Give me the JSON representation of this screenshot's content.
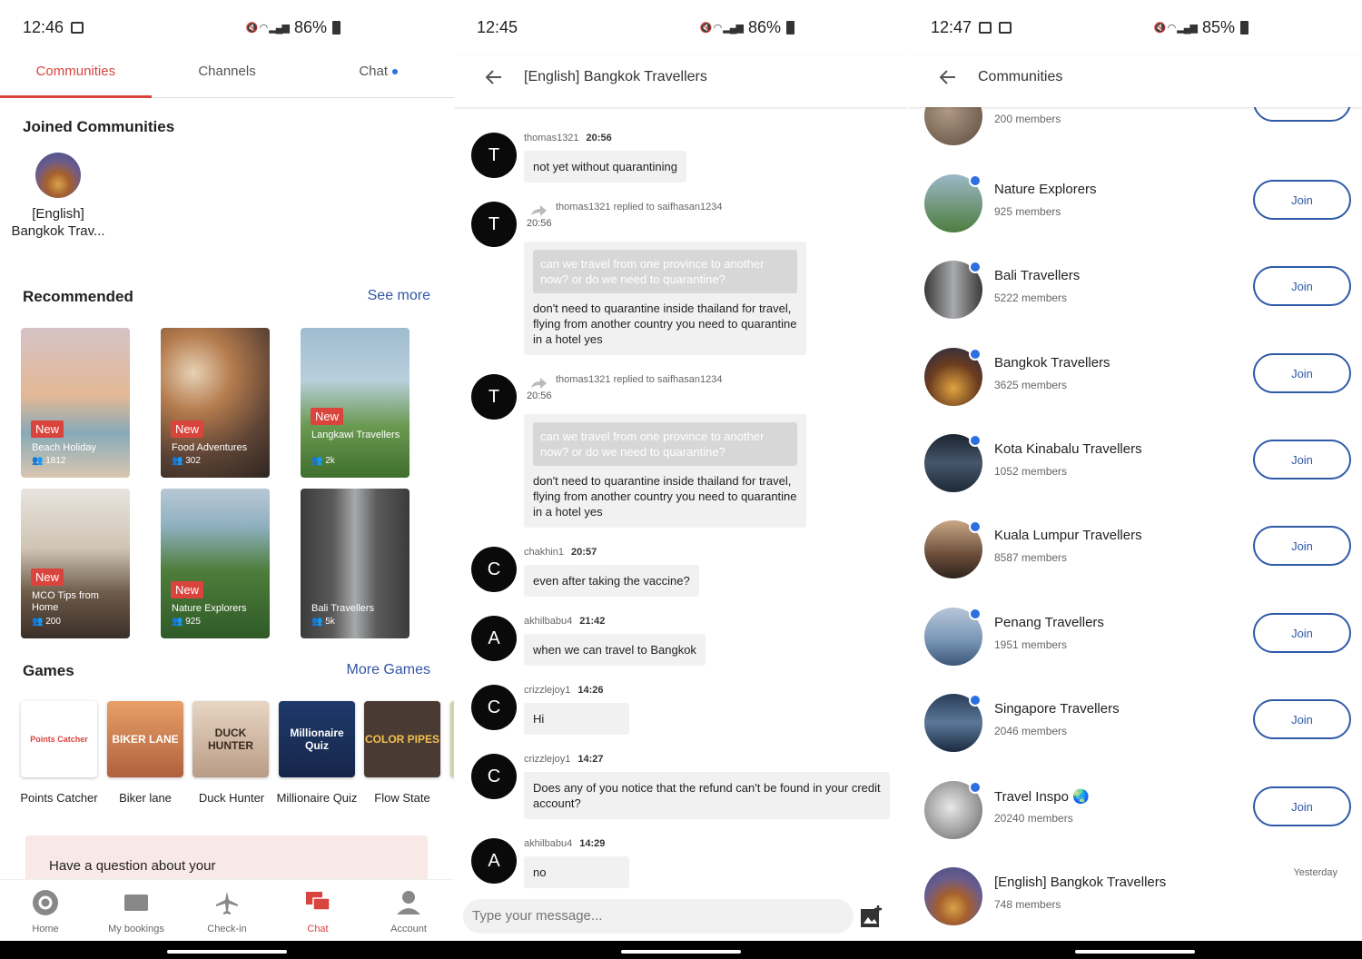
{
  "panel1": {
    "status": {
      "time": "12:46",
      "battery": "86%"
    },
    "tabs": [
      {
        "label": "Communities"
      },
      {
        "label": "Channels"
      },
      {
        "label": "Chat"
      }
    ],
    "joined_title": "Joined Communities",
    "joined": [
      {
        "name": "[English] Bangkok Trav..."
      }
    ],
    "recommended_title": "Recommended",
    "see_more": "See more",
    "cards": [
      {
        "badge": "New",
        "name": "Beach Holiday",
        "count": "1812"
      },
      {
        "badge": "New",
        "name": "Food Adventures",
        "count": "302"
      },
      {
        "badge": "New",
        "name": "Langkawi Travellers",
        "count": "2k"
      },
      {
        "badge": "New",
        "name": "MCO Tips from Home",
        "count": "200"
      },
      {
        "badge": "New",
        "name": "Nature Explorers",
        "count": "925"
      },
      {
        "badge": "",
        "name": "Bali Travellers",
        "count": "5k"
      }
    ],
    "games_title": "Games",
    "more_games": "More Games",
    "games": [
      {
        "name": "Points Catcher",
        "art": "Points Catcher"
      },
      {
        "name": "Biker lane",
        "art": "BIKER LANE"
      },
      {
        "name": "Duck Hunter",
        "art": "DUCK HUNTER"
      },
      {
        "name": "Millionaire Quiz",
        "art": "Millionaire Quiz"
      },
      {
        "name": "Flow State",
        "art": "COLOR PIPES"
      }
    ],
    "question": "Have a question about your",
    "bottom_nav": [
      {
        "label": "Home"
      },
      {
        "label": "My bookings"
      },
      {
        "label": "Check-in"
      },
      {
        "label": "Chat"
      },
      {
        "label": "Account"
      }
    ]
  },
  "panel2": {
    "status": {
      "time": "12:45",
      "battery": "86%"
    },
    "title": "[English] Bangkok Travellers",
    "messages": [
      {
        "initial": "T",
        "user": "thomas1321",
        "time": "20:56",
        "text": "not yet without quarantining"
      },
      {
        "initial": "T",
        "reply_meta": "thomas1321 replied to saifhasan1234",
        "time": "20:56",
        "quote": "can we travel from one province to another now? or do we need to quarantine?",
        "text": "don't need to quarantine inside thailand for travel, flying from another country you need to quarantine in a hotel yes"
      },
      {
        "initial": "T",
        "reply_meta": "thomas1321 replied to saifhasan1234",
        "time": "20:56",
        "quote": "can we travel from one province to another now? or do we need to quarantine?",
        "text": "don't need to quarantine inside thailand for travel, flying from another country you need to quarantine in a hotel yes"
      },
      {
        "initial": "C",
        "user": "chakhin1",
        "time": "20:57",
        "text": "even after taking the vaccine?"
      },
      {
        "initial": "A",
        "user": "akhilbabu4",
        "time": "21:42",
        "text": "when we can travel to Bangkok"
      },
      {
        "initial": "C",
        "user": "crizzlejoy1",
        "time": "14:26",
        "text": "Hi"
      },
      {
        "initial": "C",
        "user": "crizzlejoy1",
        "time": "14:27",
        "text": "Does any of you notice that the refund can't be found in your credit account?"
      },
      {
        "initial": "A",
        "user": "akhilbabu4",
        "time": "14:29",
        "text": "no"
      }
    ],
    "input_placeholder": "Type your message..."
  },
  "panel3": {
    "status": {
      "time": "12:47",
      "battery": "85%"
    },
    "title": "Communities",
    "join_label": "Join",
    "communities": [
      {
        "name": "",
        "members": "200 members"
      },
      {
        "name": "Nature Explorers",
        "members": "925 members"
      },
      {
        "name": "Bali Travellers",
        "members": "5222 members"
      },
      {
        "name": "Bangkok Travellers",
        "members": "3625 members"
      },
      {
        "name": "Kota Kinabalu Travellers",
        "members": "1052 members"
      },
      {
        "name": "Kuala Lumpur Travellers",
        "members": "8587 members"
      },
      {
        "name": "Penang Travellers",
        "members": "1951 members"
      },
      {
        "name": "Singapore Travellers",
        "members": "2046 members"
      },
      {
        "name": "Travel Inspo 🌏",
        "members": "20240 members"
      },
      {
        "name": "[English] Bangkok Travellers",
        "members": "748 members"
      }
    ],
    "yesterday": "Yesterday"
  },
  "colors": {
    "accent": "#d9443d",
    "link": "#3355a6",
    "join": "#2e5aa8",
    "unread": "#2d6ee0"
  }
}
